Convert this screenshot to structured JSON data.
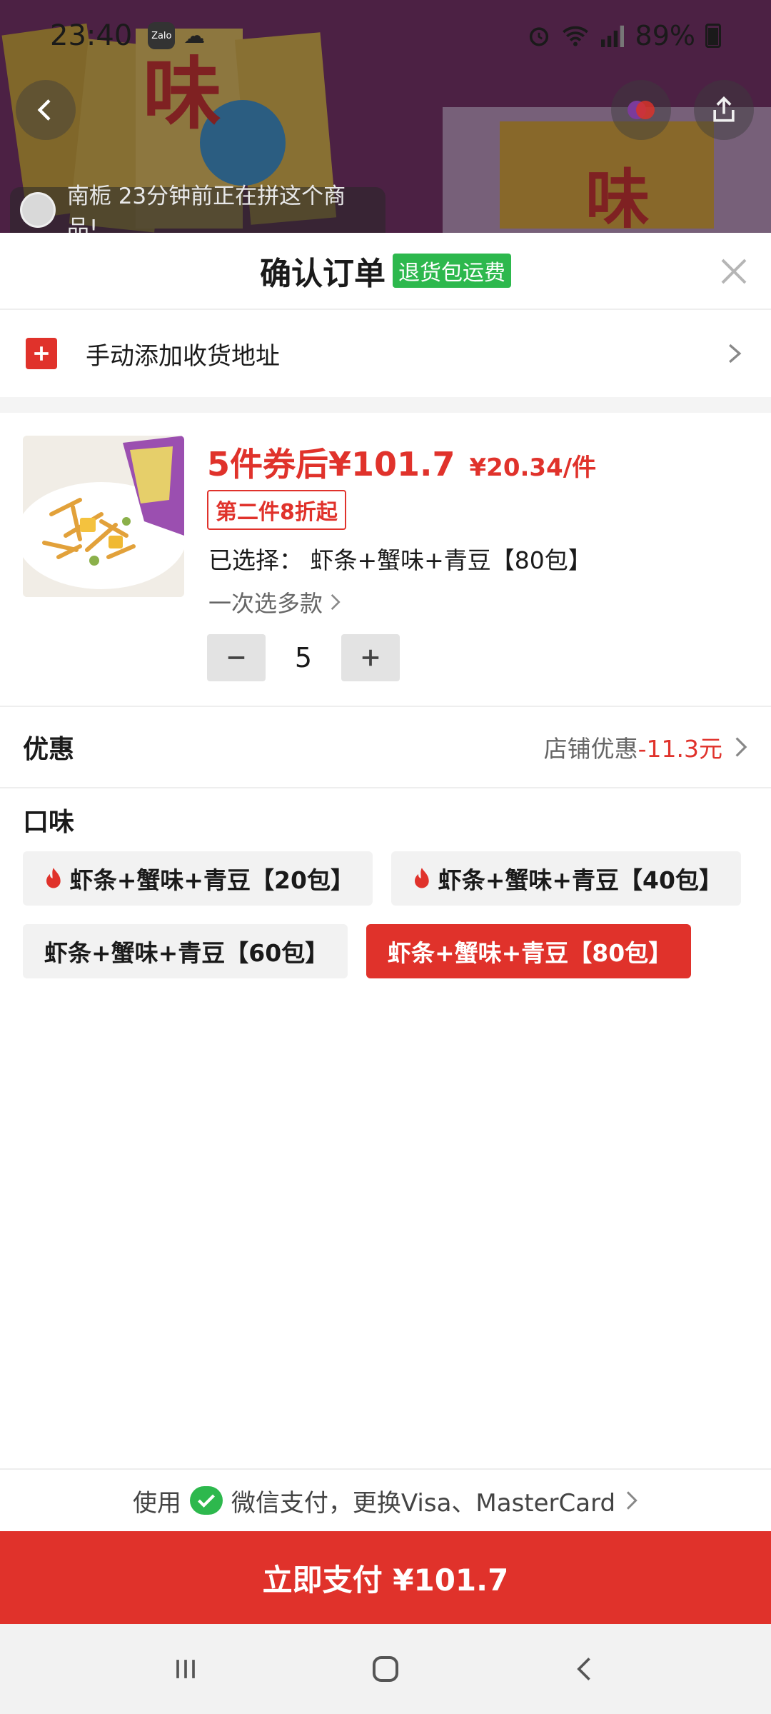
{
  "status_bar": {
    "time": "23:40",
    "zalo_label": "Zalo",
    "battery": "89%"
  },
  "background": {
    "ticker_text": "南栀 23分钟前正在拼这个商品!"
  },
  "sheet": {
    "title": "确认订单",
    "badge": "退货包运费"
  },
  "address": {
    "label": "手动添加收货地址"
  },
  "product": {
    "coupon_price": "5件券后¥101.7",
    "unit_price": "¥20.34/件",
    "promo_tag": "第二件8折起",
    "selected_prefix": "已选择：",
    "selected_value": "虾条+蟹味+青豆【80包】",
    "multi_select": "一次选多款",
    "quantity": "5"
  },
  "discount": {
    "label": "优惠",
    "prefix": "店铺优惠",
    "amount": "-11.3元"
  },
  "flavor": {
    "label": "口味",
    "options": [
      {
        "label": "虾条+蟹味+青豆【20包】",
        "hot": true
      },
      {
        "label": "虾条+蟹味+青豆【40包】",
        "hot": true
      },
      {
        "label": "虾条+蟹味+青豆【60包】",
        "hot": false
      },
      {
        "label": "虾条+蟹味+青豆【80包】",
        "hot": false,
        "selected": true
      }
    ]
  },
  "payment": {
    "prefix": "使用",
    "method": "微信支付，更换Visa、MasterCard",
    "button": "立即支付 ¥101.7"
  },
  "colors": {
    "accent": "#e0322b",
    "wechat": "#2db84d"
  }
}
